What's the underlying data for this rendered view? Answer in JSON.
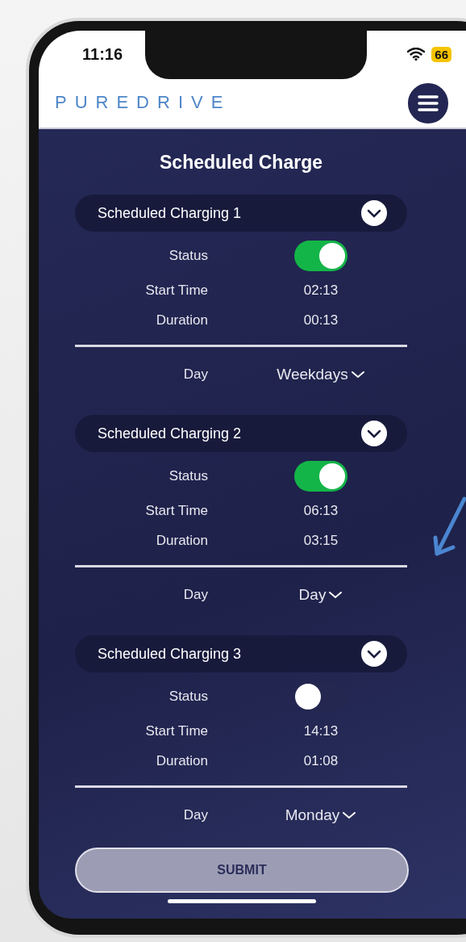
{
  "status_bar": {
    "time": "11:16",
    "battery": "66"
  },
  "header": {
    "logo": "PUREDRIVE"
  },
  "title": "Scheduled Charge",
  "schedules": [
    {
      "title": "Scheduled Charging 1",
      "status_label": "Status",
      "status_on": true,
      "start_label": "Start Time",
      "start_time": "02:13",
      "duration_label": "Duration",
      "duration": "00:13",
      "day_label": "Day",
      "day": "Weekdays"
    },
    {
      "title": "Scheduled Charging 2",
      "status_label": "Status",
      "status_on": true,
      "start_label": "Start Time",
      "start_time": "06:13",
      "duration_label": "Duration",
      "duration": "03:15",
      "day_label": "Day",
      "day": "Day"
    },
    {
      "title": "Scheduled Charging 3",
      "status_label": "Status",
      "status_on": false,
      "start_label": "Start Time",
      "start_time": "14:13",
      "duration_label": "Duration",
      "duration": "01:08",
      "day_label": "Day",
      "day": "Monday"
    }
  ],
  "submit_button": "SUBMIT"
}
